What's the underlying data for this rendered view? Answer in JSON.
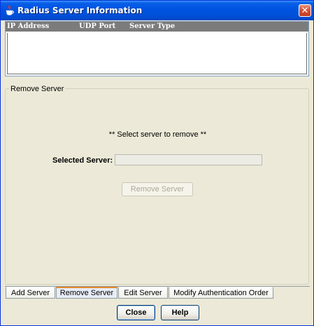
{
  "window": {
    "title": "Radius Server Information",
    "close_glyph": "✕",
    "icon": "java-cup-icon"
  },
  "server_list": {
    "columns": [
      "IP Address",
      "UDP Port",
      "Server Type"
    ],
    "rows": []
  },
  "remove_panel": {
    "group_title": "Remove Server",
    "hint": "** Select server to remove **",
    "selected_label": "Selected Server:",
    "selected_value": "",
    "remove_button": "Remove Server"
  },
  "tabs": [
    {
      "label": "Add Server",
      "active": false
    },
    {
      "label": "Remove Server",
      "active": true
    },
    {
      "label": "Edit Server",
      "active": false
    },
    {
      "label": "Modify Authentication Order",
      "active": false
    }
  ],
  "footer": {
    "close_label": "Close",
    "help_label": "Help"
  },
  "colors": {
    "titlebar": "#0054e3",
    "window_bg": "#ece9d8",
    "list_header": "#7b7b7b",
    "active_tab_accent": "#e68b2c"
  }
}
